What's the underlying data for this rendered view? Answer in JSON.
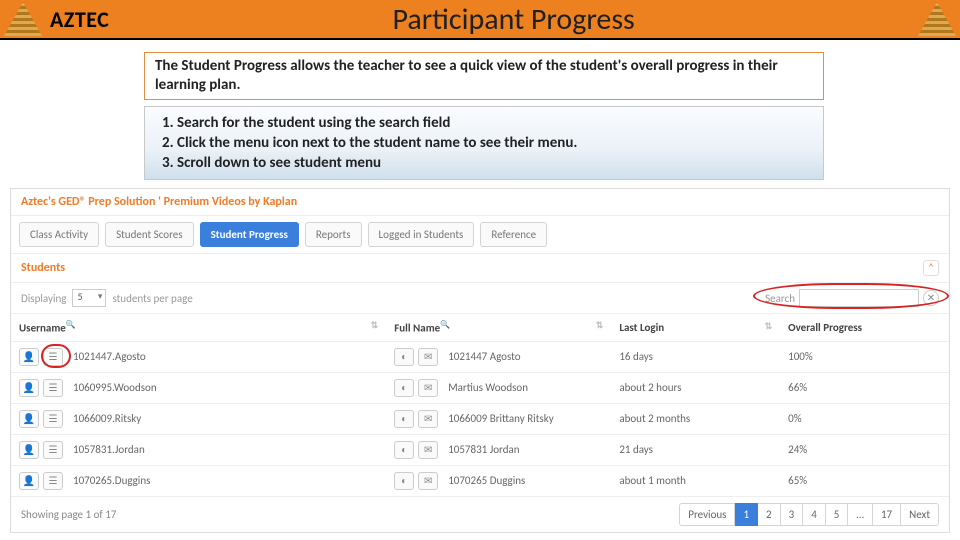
{
  "header": {
    "brand": "AZTEC",
    "title": "Participant Progress"
  },
  "description": "The Student Progress allows the teacher to see a quick view of the student's overall progress in their learning plan.",
  "steps": [
    "Search for the student using the search field",
    "Click the menu icon next to the student name to see their menu.",
    "Scroll down to see student menu"
  ],
  "app": {
    "breadcrumb": "Aztec's GED® Prep Solution ' Premium Videos by Kaplan",
    "tabs": [
      "Class Activity",
      "Student Scores",
      "Student Progress",
      "Reports",
      "Logged in Students",
      "Reference"
    ],
    "active_tab": "Student Progress",
    "panel_title": "Students",
    "toolbar": {
      "displaying": "Displaying",
      "per_page_value": "5",
      "students_per_page": "students per page",
      "search_label": "Search"
    },
    "columns": {
      "username": "Username",
      "fullname": "Full Name",
      "lastlogin": "Last Login",
      "overall": "Overall Progress"
    },
    "rows": [
      {
        "username": "1021447.Agosto",
        "fullname": "1021447 Agosto",
        "lastlogin": "16 days",
        "overall": "100%"
      },
      {
        "username": "1060995.Woodson",
        "fullname": "Martius Woodson",
        "lastlogin": "about 2 hours",
        "overall": "66%"
      },
      {
        "username": "1066009.Ritsky",
        "fullname": "1066009 Brittany Ritsky",
        "lastlogin": "about 2 months",
        "overall": "0%"
      },
      {
        "username": "1057831.Jordan",
        "fullname": "1057831 Jordan",
        "lastlogin": "21 days",
        "overall": "24%"
      },
      {
        "username": "1070265.Duggins",
        "fullname": "1070265 Duggins",
        "lastlogin": "about 1 month",
        "overall": "65%"
      }
    ],
    "pager": {
      "info": "Showing page 1 of 17",
      "prev": "Previous",
      "pages": [
        "1",
        "2",
        "3",
        "4",
        "5",
        "…",
        "17"
      ],
      "next": "Next"
    }
  }
}
